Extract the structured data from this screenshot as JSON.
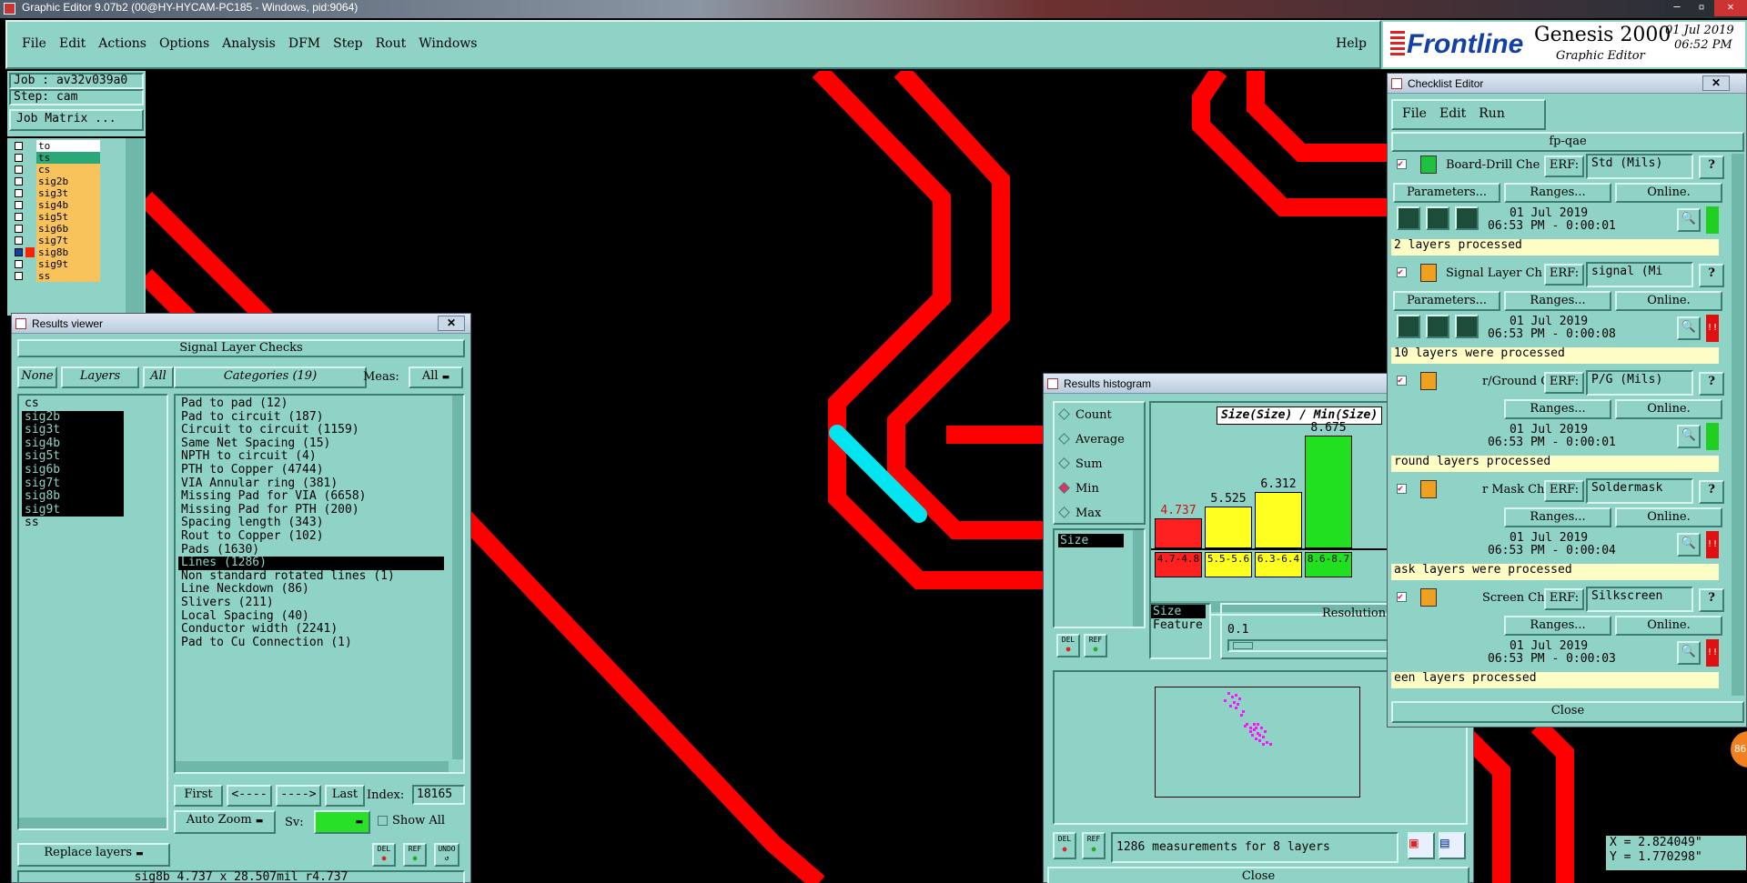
{
  "titlebar": {
    "title": "Graphic Editor 9.07b2 (00@HY-HYCAM-PC185 - Windows, pid:9064)"
  },
  "menu": {
    "items": [
      "File",
      "Edit",
      "Actions",
      "Options",
      "Analysis",
      "DFM",
      "Step",
      "Rout",
      "Windows"
    ],
    "help": "Help"
  },
  "brand": {
    "logo": "Frontline",
    "product": "Genesis 2000",
    "subtitle": "Graphic Editor",
    "date": "01 Jul 2019",
    "time": "06:52 PM"
  },
  "job": {
    "job_label": "Job : av32v039a0",
    "step_label": "Step: cam",
    "matrix_button": "Job Matrix ..."
  },
  "layers": [
    "to",
    "ts",
    "cs",
    "sig2b",
    "sig3t",
    "sig4b",
    "sig5t",
    "sig6b",
    "sig7t",
    "sig8b",
    "sig9t",
    "ss"
  ],
  "results_viewer": {
    "title": "Results viewer",
    "header": "Signal Layer Checks",
    "btn_none": "None",
    "btn_layers": "Layers",
    "btn_all": "All",
    "categories_label": "Categories (19)",
    "meas_label": "Meas:",
    "meas_value": "All",
    "layer_list": [
      "cs",
      "sig2b",
      "sig3t",
      "sig4b",
      "sig5t",
      "sig6b",
      "sig7t",
      "sig8b",
      "sig9t",
      "ss"
    ],
    "categories": [
      "Pad to pad (12)",
      "Pad to circuit (187)",
      "Circuit to circuit (1159)",
      "Same Net Spacing (15)",
      "NPTH to circuit (4)",
      "PTH to Copper (4744)",
      "VIA Annular ring (381)",
      "Missing Pad for VIA (6658)",
      "Missing Pad for PTH (200)",
      "Spacing length (343)",
      "Rout to Copper (102)",
      "Pads (1630)",
      "Lines (1286)",
      "Non standard rotated lines (1)",
      "Line Neckdown (86)",
      "Slivers (211)",
      "Local Spacing (40)",
      "Conductor width (2241)",
      "Pad to Cu Connection (1)"
    ],
    "selected_category": "Lines (1286)",
    "nav": {
      "first": "First",
      "prev": "<----",
      "next": "---->",
      "last": "Last",
      "index_label": "Index:",
      "index_value": "18165"
    },
    "zoom": "Auto Zoom",
    "sv_label": "Sv:",
    "show_all": "Show All",
    "replace_layers": "Replace layers",
    "icons": [
      "DEL",
      "REF",
      "UNDO"
    ],
    "status": "sig8b 4.737 x 28.507mil  r4.737"
  },
  "histogram": {
    "title": "Results histogram",
    "modes": [
      "Count",
      "Average",
      "Sum",
      "Min",
      "Max"
    ],
    "selected_mode": "Min",
    "size_list": [
      "Size"
    ],
    "chart_title": "Size(Size) / Min(Size)",
    "bars": [
      {
        "value": "4.737",
        "range": "4.7-4.8",
        "color": "#ff2020"
      },
      {
        "value": "5.525",
        "range": "5.5-5.6",
        "color": "#ffff20"
      },
      {
        "value": "6.312",
        "range": "6.3-6.4",
        "color": "#ffff20"
      },
      {
        "value": "8.675",
        "range": "8.6-8.7",
        "color": "#20e020"
      }
    ],
    "param_list": [
      "Size",
      "Feature"
    ],
    "resolution_label": "Resolution",
    "resolution_value": "0.1",
    "measurements": "1286 measurements for 8 layers",
    "close": "Close"
  },
  "checklist": {
    "title": "Checklist Editor",
    "menu": [
      "File",
      "Edit",
      "Run"
    ],
    "name": "fp-qae",
    "items": [
      {
        "name": "Board-Drill Che",
        "erf": "Std (Mils)",
        "date": "01 Jul 2019",
        "time": "06:53 PM - 0:00:01",
        "status": "2 layers processed",
        "state": "green"
      },
      {
        "name": "Signal Layer Ch",
        "erf": "signal (Mi",
        "date": "01 Jul 2019",
        "time": "06:53 PM - 0:00:08",
        "status": "10 layers were processed",
        "state": "red"
      },
      {
        "name": "r/Ground C",
        "erf": "P/G (Mils)",
        "date": "01 Jul 2019",
        "time": "06:53 PM - 0:00:01",
        "status": "round layers processed",
        "state": "green"
      },
      {
        "name": "r Mask Ch",
        "erf": "Soldermask",
        "date": "01 Jul 2019",
        "time": "06:53 PM - 0:00:04",
        "status": "ask layers were processed",
        "state": "red"
      },
      {
        "name": "Screen Che",
        "erf": "Silkscreen",
        "date": "01 Jul 2019",
        "time": "06:53 PM - 0:00:03",
        "status": "een layers processed",
        "state": "red"
      }
    ],
    "buttons": {
      "params": "Parameters...",
      "ranges": "Ranges...",
      "online": "Online.",
      "erf": "ERF:",
      "help": "?"
    },
    "close": "Close"
  },
  "coords": {
    "x": "X = 2.824049\"",
    "y": "Y = 1.770298\""
  },
  "badge": "86"
}
